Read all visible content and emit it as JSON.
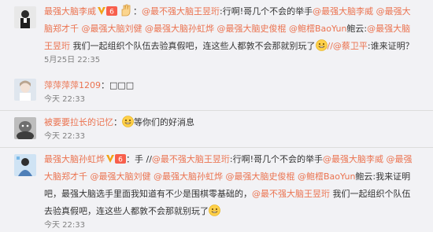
{
  "comments": [
    {
      "name": "最强大脑李威",
      "verified": true,
      "vip_level": "6",
      "segments": [
        {
          "t": "text",
          "v": "："
        },
        {
          "t": "mention",
          "v": "@最不强大脑王昱珩"
        },
        {
          "t": "text",
          "v": ":行啊!哥几个不会的举手"
        },
        {
          "t": "mention",
          "v": "@最强大脑李威"
        },
        {
          "t": "text",
          "v": " "
        },
        {
          "t": "mention",
          "v": "@最强大脑郑才千"
        },
        {
          "t": "text",
          "v": " "
        },
        {
          "t": "mention",
          "v": "@最强大脑刘健"
        },
        {
          "t": "text",
          "v": " "
        },
        {
          "t": "mention",
          "v": "@最强大脑孙虹烨"
        },
        {
          "t": "text",
          "v": " "
        },
        {
          "t": "mention",
          "v": "@最强大脑史俊棍"
        },
        {
          "t": "text",
          "v": " "
        },
        {
          "t": "mention",
          "v": "@鲍橒BaoYun"
        },
        {
          "t": "text",
          "v": "鲍云:"
        },
        {
          "t": "mention",
          "v": "@最强大脑王昱珩"
        },
        {
          "t": "text",
          "v": " 我们一起组织个队伍去验真假吧，连这些人都敦不会那就别玩了"
        },
        {
          "t": "emoji",
          "v": "grin-emoji"
        },
        {
          "t": "mention",
          "v": "//@蔡卫平"
        },
        {
          "t": "text",
          "v": ":谁来证明？"
        }
      ],
      "time": "5月25日 22:35"
    },
    {
      "name": "萍萍萍萍1209",
      "segments": [
        {
          "t": "text",
          "v": "：□□□"
        }
      ],
      "time": "今天 22:33"
    },
    {
      "name": "被要要拉长的记忆",
      "segments": [
        {
          "t": "text",
          "v": "："
        },
        {
          "t": "emoji",
          "v": "grin-emoji"
        },
        {
          "t": "text",
          "v": "等你们的好消息"
        }
      ],
      "time": "今天 22:33"
    },
    {
      "name": "最强大脑孙虹烨",
      "verified": true,
      "vip_level": "6",
      "segments": [
        {
          "t": "text",
          "v": "：手 //"
        },
        {
          "t": "mention",
          "v": "@最不强大脑王昱珩"
        },
        {
          "t": "text",
          "v": ":行啊!哥几个不会的举手"
        },
        {
          "t": "mention",
          "v": "@最强大脑李威"
        },
        {
          "t": "text",
          "v": " "
        },
        {
          "t": "mention",
          "v": "@最强大脑郑才千"
        },
        {
          "t": "text",
          "v": " "
        },
        {
          "t": "mention",
          "v": "@最强大脑刘健"
        },
        {
          "t": "text",
          "v": " "
        },
        {
          "t": "mention",
          "v": "@最强大脑孙虹烨"
        },
        {
          "t": "text",
          "v": " "
        },
        {
          "t": "mention",
          "v": "@最强大脑史俊棍"
        },
        {
          "t": "text",
          "v": " "
        },
        {
          "t": "mention",
          "v": "@鲍橒BaoYun"
        },
        {
          "t": "text",
          "v": "鲍云:我来证明吧，最强大脑选手里面我知道有不少是围棋零基础的，"
        },
        {
          "t": "mention",
          "v": "@最不强大脑王昱珩"
        },
        {
          "t": "text",
          "v": " 我们一起组织个队伍去验真假吧，连这些人都敦不会那就别玩了"
        },
        {
          "t": "emoji",
          "v": "grin-emoji"
        }
      ],
      "time": "今天 22:33"
    }
  ],
  "colors": {
    "link": "#eb7350",
    "text": "#333333",
    "time": "#808080",
    "bg": "#f2f2f5"
  }
}
